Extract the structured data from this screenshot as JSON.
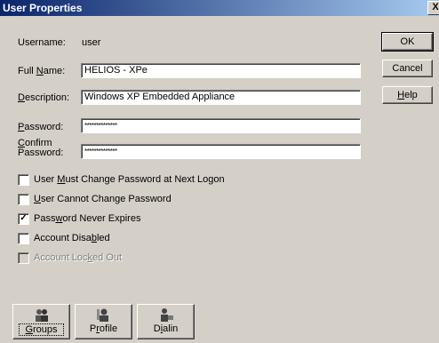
{
  "window": {
    "title": "User Properties",
    "close": "X"
  },
  "form": {
    "username_label": "Username:",
    "username_value": "user",
    "fullname_label_pre": "Full ",
    "fullname_label_ul": "N",
    "fullname_label_post": "ame:",
    "fullname_value": "HELIOS - XPe",
    "description_label_ul": "D",
    "description_label_post": "escription:",
    "description_value": "Windows XP Embedded Appliance",
    "password_label_ul": "P",
    "password_label_post": "assword:",
    "password_value": "**************",
    "confirm_label_line1_ul": "C",
    "confirm_label_line1_post": "onfirm",
    "confirm_label_line2": "Password:",
    "confirm_value": "**************"
  },
  "buttons": {
    "ok": "OK",
    "cancel": "Cancel",
    "help_ul": "H",
    "help_post": "elp"
  },
  "checkboxes": [
    {
      "pre": "User ",
      "ul": "M",
      "post": "ust Change Password at Next Logon",
      "checked": false,
      "enabled": true
    },
    {
      "pre": "",
      "ul": "U",
      "post": "ser Cannot Change Password",
      "checked": false,
      "enabled": true
    },
    {
      "pre": "Pass",
      "ul": "w",
      "post": "ord Never Expires",
      "checked": true,
      "enabled": true
    },
    {
      "pre": "Account Disa",
      "ul": "b",
      "post": "led",
      "checked": false,
      "enabled": true
    },
    {
      "pre": "Account Loc",
      "ul": "k",
      "post": "ed Out",
      "checked": false,
      "enabled": false
    }
  ],
  "bottom_buttons": {
    "groups_ul": "G",
    "groups_post": "roups",
    "profile_pre": "P",
    "profile_ul": "r",
    "profile_post": "ofile",
    "dialin_pre": "D",
    "dialin_ul": "i",
    "dialin_post": "alin",
    "groups_icon": "groups-icon",
    "profile_icon": "profile-icon",
    "dialin_icon": "dialin-icon"
  }
}
